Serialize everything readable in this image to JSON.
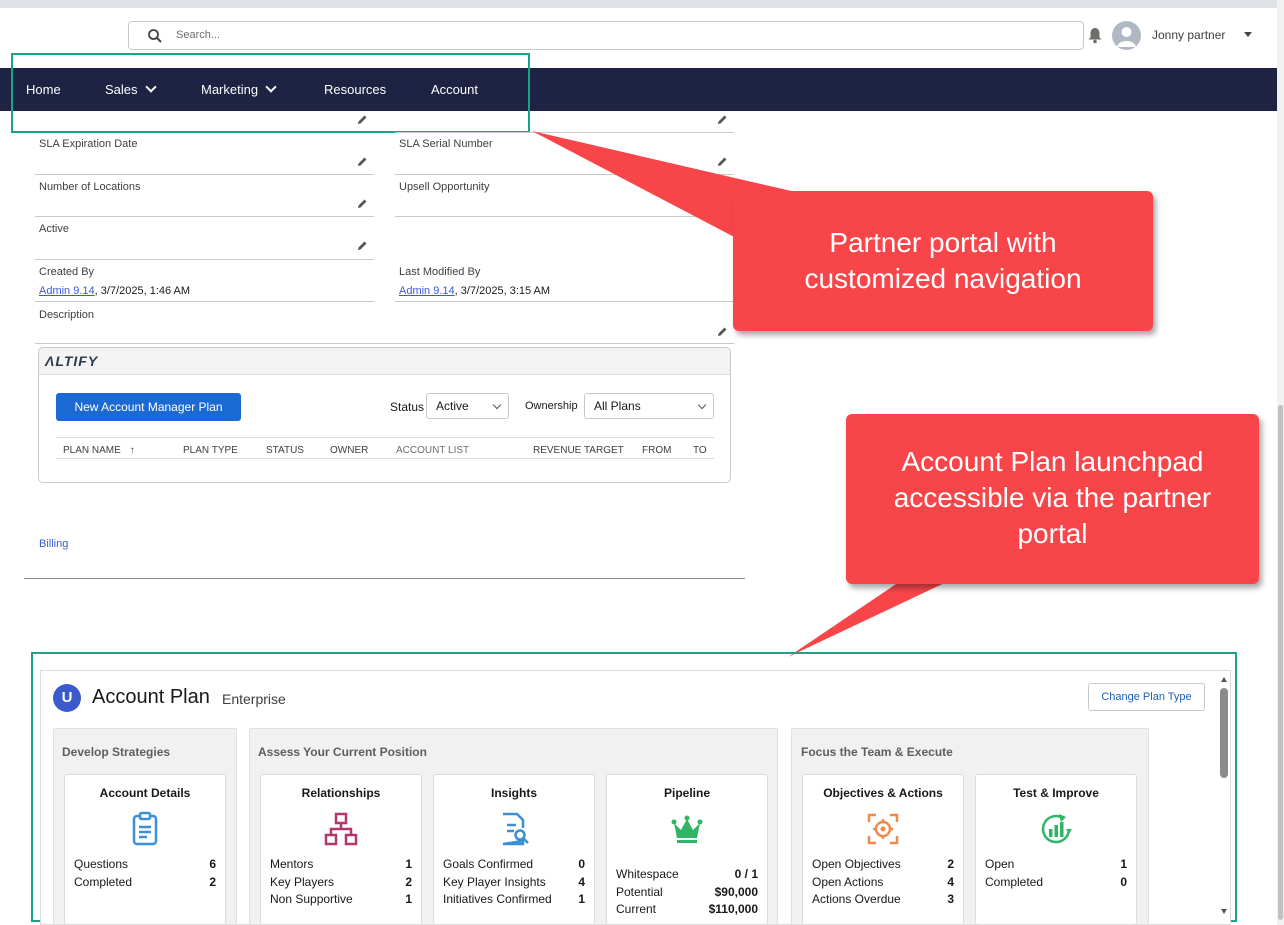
{
  "header": {
    "search_placeholder": "Search...",
    "user_name": "Jonny partner"
  },
  "nav": {
    "items": [
      {
        "label": "Home",
        "has_menu": false
      },
      {
        "label": "Sales",
        "has_menu": true
      },
      {
        "label": "Marketing",
        "has_menu": true
      },
      {
        "label": "Resources",
        "has_menu": false
      },
      {
        "label": "Account",
        "has_menu": false
      }
    ]
  },
  "fields": {
    "sla_expiration_label": "SLA Expiration Date",
    "sla_serial_label": "SLA Serial Number",
    "locations_label": "Number of Locations",
    "upsell_label": "Upsell Opportunity",
    "active_label": "Active",
    "created_by_label": "Created By",
    "created_by_user": "Admin 9.14",
    "created_by_date": ", 3/7/2025, 1:46 AM",
    "modified_by_label": "Last Modified By",
    "modified_by_user": "Admin 9.14",
    "modified_by_date": ", 3/7/2025, 3:15 AM",
    "description_label": "Description",
    "billing_link": "Billing"
  },
  "altify": {
    "logo": "ΛLTIFY",
    "new_plan_button": "New Account Manager Plan",
    "status_label": "Status",
    "status_value": "Active",
    "ownership_label": "Ownership",
    "ownership_value": "All Plans",
    "columns": [
      "PLAN NAME",
      "PLAN TYPE",
      "STATUS",
      "OWNER",
      "ACCOUNT LIST",
      "REVENUE TARGET",
      "FROM",
      "TO"
    ],
    "sort_indicator": "↑"
  },
  "callouts": {
    "nav_callout": "Partner portal with customized navigation",
    "plan_callout": "Account Plan launchpad accessible via the partner portal"
  },
  "account_plan": {
    "logo_letter": "U",
    "title": "Account Plan",
    "subtitle": "Enterprise",
    "change_button": "Change Plan Type",
    "groups": [
      {
        "title": "Develop Strategies"
      },
      {
        "title": "Assess Your Current Position"
      },
      {
        "title": "Focus the Team & Execute"
      }
    ],
    "tiles": {
      "account_details": {
        "title": "Account Details",
        "rows": [
          {
            "k": "Questions",
            "v": "6"
          },
          {
            "k": "Completed",
            "v": "2"
          }
        ]
      },
      "relationships": {
        "title": "Relationships",
        "rows": [
          {
            "k": "Mentors",
            "v": "1"
          },
          {
            "k": "Key Players",
            "v": "2"
          },
          {
            "k": "Non Supportive",
            "v": "1"
          }
        ]
      },
      "insights": {
        "title": "Insights",
        "rows": [
          {
            "k": "Goals Confirmed",
            "v": "0"
          },
          {
            "k": "Key Player Insights",
            "v": "4"
          },
          {
            "k": "Initiatives Confirmed",
            "v": "1"
          }
        ]
      },
      "pipeline": {
        "title": "Pipeline",
        "rows": [
          {
            "k": "Whitespace",
            "v": "0 / 1"
          },
          {
            "k": "Potential",
            "v": "$90,000"
          },
          {
            "k": "Current",
            "v": "$110,000"
          }
        ]
      },
      "objectives": {
        "title": "Objectives & Actions",
        "rows": [
          {
            "k": "Open Objectives",
            "v": "2"
          },
          {
            "k": "Open Actions",
            "v": "4"
          },
          {
            "k": "Actions Overdue",
            "v": "3"
          }
        ]
      },
      "test_improve": {
        "title": "Test & Improve",
        "rows": [
          {
            "k": "Open",
            "v": "1"
          },
          {
            "k": "Completed",
            "v": "0"
          }
        ]
      }
    }
  },
  "colors": {
    "nav_bg": "#1e2243",
    "highlight": "#1aa387",
    "callout": "#f8454a",
    "primary_button": "#1b6ad4"
  }
}
